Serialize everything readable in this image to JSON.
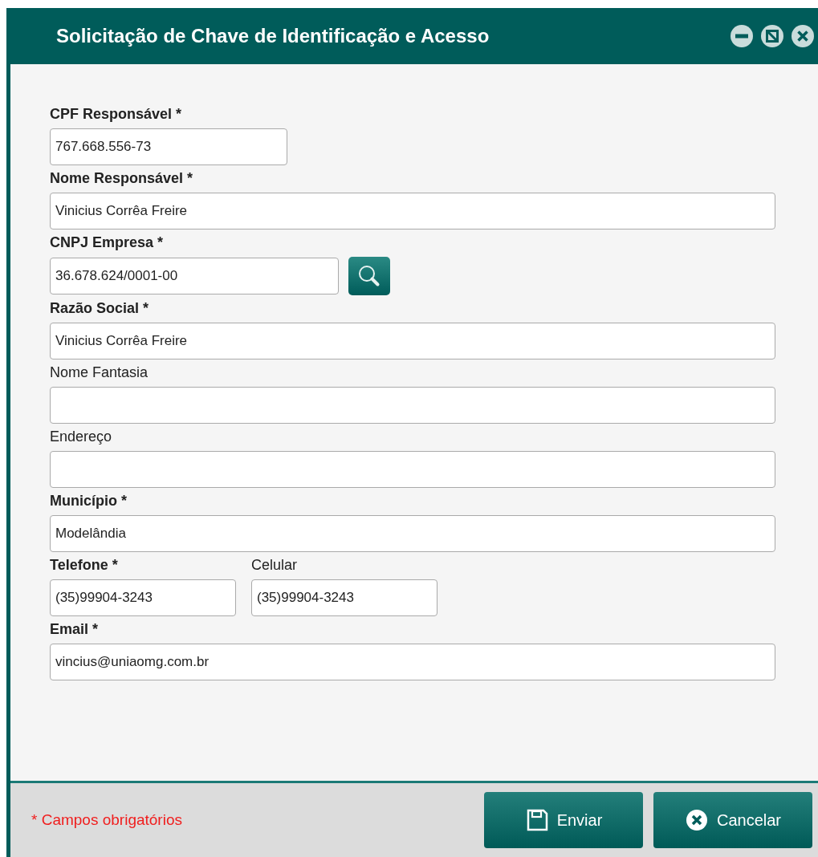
{
  "window": {
    "title": "Solicitação de Chave de Identificação e Acesso"
  },
  "rows": [
    {
      "fields": [
        {
          "label": "CPF Responsável *",
          "required": true,
          "value": "767.668.556-73",
          "kind": "short"
        }
      ]
    },
    {
      "fields": [
        {
          "label": "Nome Responsável *",
          "required": true,
          "value": "Vinicius Corrêa Freire",
          "kind": "full"
        }
      ]
    },
    {
      "fields": [
        {
          "label": "CNPJ Empresa *",
          "required": true,
          "value": "36.678.624/0001-00",
          "kind": "lookup"
        }
      ]
    },
    {
      "fields": [
        {
          "label": "Razão Social *",
          "required": true,
          "value": "Vinicius Corrêa Freire",
          "kind": "full"
        }
      ]
    },
    {
      "fields": [
        {
          "label": "Nome Fantasia",
          "required": false,
          "kind": "full"
        }
      ]
    },
    {
      "fields": [
        {
          "label": "Endereço",
          "required": false,
          "kind": "full"
        }
      ]
    },
    {
      "fields": [
        {
          "label": "Município *",
          "required": true,
          "value": "Modelândia",
          "kind": "full"
        }
      ]
    },
    {
      "fields": [
        {
          "label": "Telefone *",
          "required": true,
          "value": "(35)99904-3243",
          "kind": "short"
        },
        {
          "label": "Celular",
          "required": false,
          "value": "(35)99904-3243",
          "kind": "short"
        }
      ]
    },
    {
      "fields": [
        {
          "label": "Email *",
          "required": true,
          "value": "vincius@uniaomg.com.br",
          "kind": "full"
        }
      ]
    }
  ],
  "footer": {
    "note": "* Campos obrigatórios",
    "buttons": [
      {
        "label": "Enviar",
        "kind": "save"
      },
      {
        "label": "Cancelar",
        "kind": "cancel"
      }
    ]
  }
}
